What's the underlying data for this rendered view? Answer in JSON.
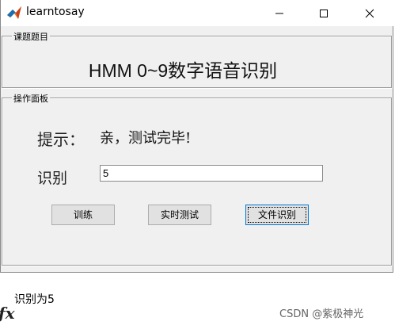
{
  "window": {
    "title": "learntosay"
  },
  "panel_title": {
    "label": "课题题目",
    "heading": "HMM 0~9数字语音识别"
  },
  "control_panel": {
    "label": "操作面板",
    "hint_label": "提示：",
    "hint_value": "亲，测试完毕!",
    "recognition_label": "识别",
    "recognition_value": "5",
    "buttons": {
      "train": "训练",
      "realtime": "实时测试",
      "file": "文件识别"
    }
  },
  "console": {
    "output": "识别为5",
    "fx_symbol": "fx"
  },
  "watermark": "CSDN @紫极神光",
  "icons": [
    "matlab-icon",
    "minimize-icon",
    "maximize-icon",
    "close-icon"
  ]
}
